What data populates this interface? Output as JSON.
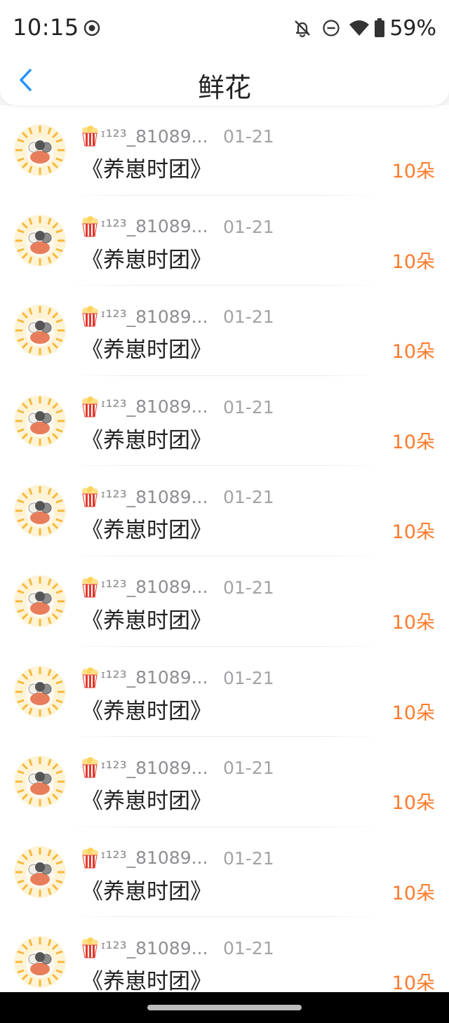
{
  "status_bar": {
    "time": "10:15",
    "battery_percent": "59%",
    "icons": [
      "screen-record-icon",
      "bell-off-icon",
      "do-not-disturb-icon",
      "wifi-icon",
      "battery-icon"
    ]
  },
  "header": {
    "title": "鲜花"
  },
  "colors": {
    "accent": "#1e90ff",
    "count": "#ff7a2b",
    "muted": "#8e8e93"
  },
  "gifts": [
    {
      "name": "ᶦ¹²³_81089...",
      "date": "01-21",
      "book": "《养崽时团》",
      "count": "10朵"
    },
    {
      "name": "ᶦ¹²³_81089...",
      "date": "01-21",
      "book": "《养崽时团》",
      "count": "10朵"
    },
    {
      "name": "ᶦ¹²³_81089...",
      "date": "01-21",
      "book": "《养崽时团》",
      "count": "10朵"
    },
    {
      "name": "ᶦ¹²³_81089...",
      "date": "01-21",
      "book": "《养崽时团》",
      "count": "10朵"
    },
    {
      "name": "ᶦ¹²³_81089...",
      "date": "01-21",
      "book": "《养崽时团》",
      "count": "10朵"
    },
    {
      "name": "ᶦ¹²³_81089...",
      "date": "01-21",
      "book": "《养崽时团》",
      "count": "10朵"
    },
    {
      "name": "ᶦ¹²³_81089...",
      "date": "01-21",
      "book": "《养崽时团》",
      "count": "10朵"
    },
    {
      "name": "ᶦ¹²³_81089...",
      "date": "01-21",
      "book": "《养崽时团》",
      "count": "10朵"
    },
    {
      "name": "ᶦ¹²³_81089...",
      "date": "01-21",
      "book": "《养崽时团》",
      "count": "10朵"
    },
    {
      "name": "ᶦ¹²³_81089...",
      "date": "01-21",
      "book": "《养崽时团》",
      "count": "10朵"
    }
  ]
}
